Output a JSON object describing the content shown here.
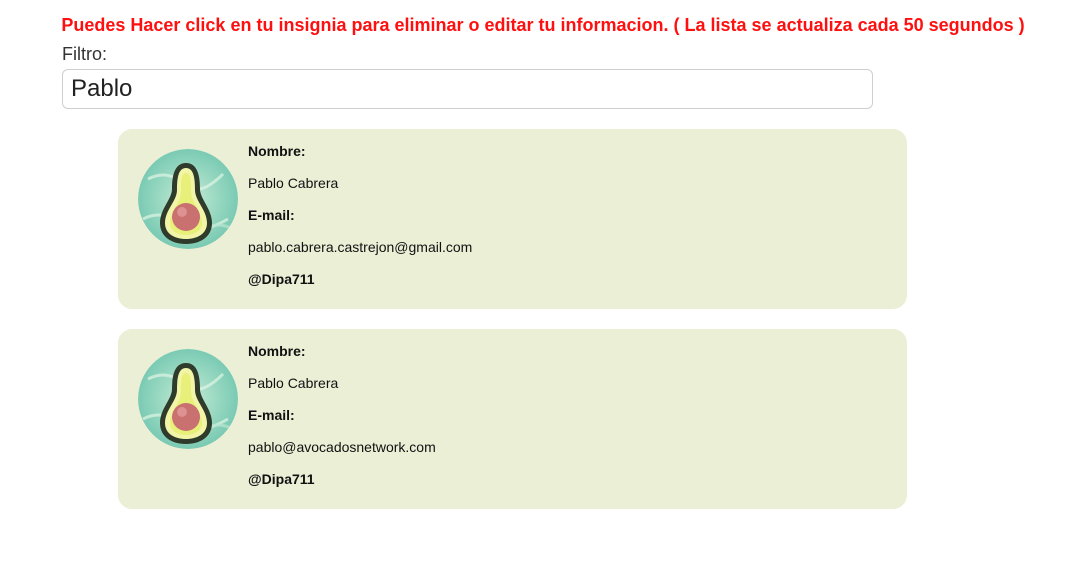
{
  "banner": "Puedes Hacer click en tu insignia para eliminar o editar tu informacion. ( La lista se actualiza cada 50 segundos )",
  "filter": {
    "label": "Filtro:",
    "value": "Pablo"
  },
  "cards": [
    {
      "name_label": "Nombre:",
      "name": "Pablo Cabrera",
      "email_label": "E-mail:",
      "email": "pablo.cabrera.castrejon@gmail.com",
      "handle": "@Dipa711",
      "avatar_icon": "avocado-icon"
    },
    {
      "name_label": "Nombre:",
      "name": "Pablo Cabrera",
      "email_label": "E-mail:",
      "email": "pablo@avocadosnetwork.com",
      "handle": "@Dipa711",
      "avatar_icon": "avocado-icon"
    }
  ],
  "colors": {
    "banner": "#ff1010",
    "card_bg": "#ebefd6"
  }
}
